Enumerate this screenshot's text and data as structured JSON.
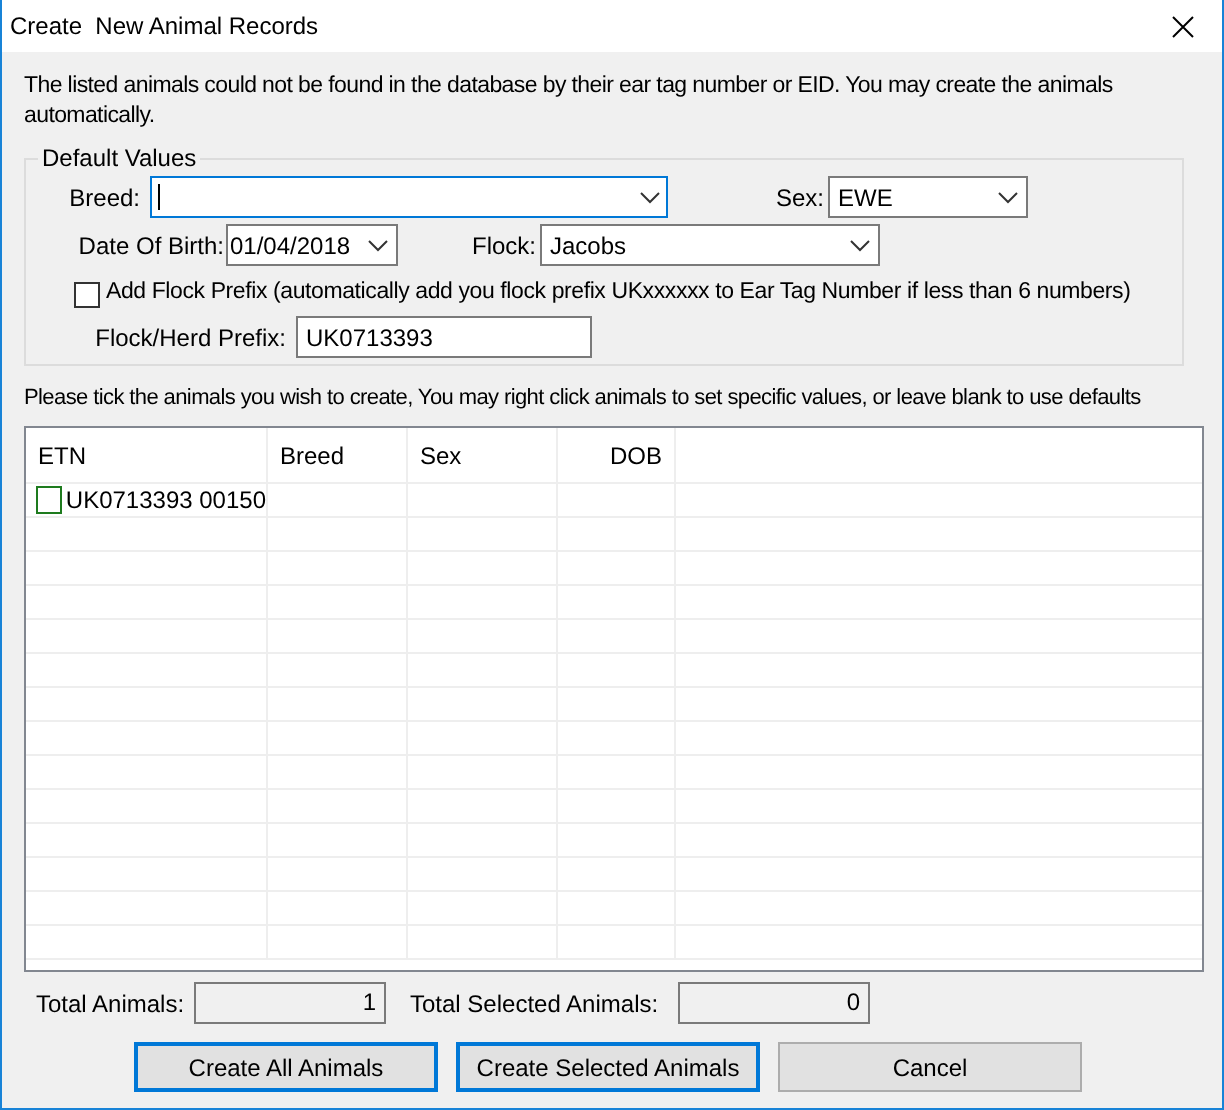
{
  "window": {
    "title": "Create  New Animal Records"
  },
  "intro": "The listed animals could not be found in the database by their ear tag number or EID. You may create the animals automatically.",
  "defaults": {
    "legend": "Default Values",
    "breed": {
      "label": "Breed:",
      "focused": true
    },
    "sex": {
      "label": "Sex:",
      "value": "EWE"
    },
    "date_of_birth": {
      "label": "Date Of Birth:",
      "value": "01/04/2018"
    },
    "flock": {
      "label": "Flock:",
      "value": "Jacobs"
    },
    "add_flock_prefix": {
      "label": "Add Flock Prefix (automatically add you flock prefix UKxxxxxx to Ear Tag Number if less than 6 numbers)",
      "checked": false
    },
    "flock_herd_prefix": {
      "label": "Flock/Herd Prefix:",
      "value": "UK0713393"
    }
  },
  "instruction": "Please tick the animals you wish to create, You may right click animals to set specific values, or leave blank to use defaults",
  "table": {
    "columns": [
      "ETN",
      "Breed",
      "Sex",
      "DOB"
    ],
    "rows": [
      {
        "etn": "UK0713393 00150",
        "checked": false
      }
    ]
  },
  "totals": [
    {
      "label": "Total Animals:",
      "value": "1"
    },
    {
      "label": "Total Selected Animals:",
      "value": "0"
    }
  ],
  "buttons": [
    {
      "label": "Create All Animals",
      "highlighted": true
    },
    {
      "label": "Create Selected Animals",
      "highlighted": true
    },
    {
      "label": "Cancel",
      "highlighted": false
    }
  ]
}
